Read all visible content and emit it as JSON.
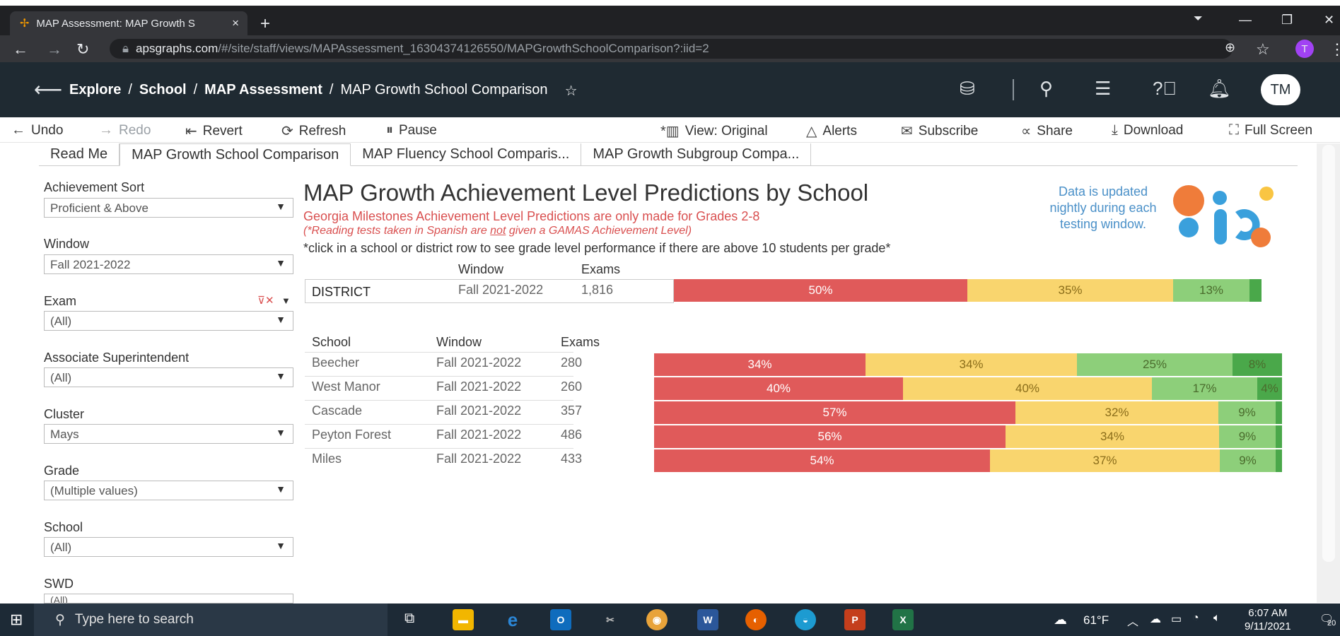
{
  "browser": {
    "tab_title": "MAP Assessment: MAP Growth S",
    "tab_close": "×",
    "new_tab": "+",
    "url_host": "apsgraphs.com",
    "url_path": "/#/site/staff/views/MAPAssessment_16304374126550/MAPGrowthSchoolComparison?:iid=2",
    "profile_initial": "T"
  },
  "header": {
    "crumbs": [
      "Explore",
      "/",
      "School",
      "/",
      "MAP Assessment",
      "/",
      "MAP Growth School Comparison"
    ],
    "avatar": "TM"
  },
  "toolbar": {
    "undo": "Undo",
    "redo": "Redo",
    "revert": "Revert",
    "refresh": "Refresh",
    "pause": "Pause",
    "view": "View: Original",
    "alerts": "Alerts",
    "subscribe": "Subscribe",
    "share": "Share",
    "download": "Download",
    "fullscreen": "Full Screen"
  },
  "sheet_tabs": [
    "Read Me",
    "MAP Growth School Comparison",
    "MAP Fluency School Comparis...",
    "MAP Growth Subgroup Compa..."
  ],
  "filters": [
    {
      "label": "Achievement Sort",
      "value": "Proficient & Above"
    },
    {
      "label": "Window",
      "value": "Fall 2021-2022"
    },
    {
      "label": "Exam",
      "value": "(All)"
    },
    {
      "label": "Associate Superintendent",
      "value": "(All)"
    },
    {
      "label": "Cluster",
      "value": "Mays"
    },
    {
      "label": "Grade",
      "value": "(Multiple values)"
    },
    {
      "label": "School",
      "value": "(All)"
    },
    {
      "label": "SWD",
      "value": "(All)"
    }
  ],
  "dashboard": {
    "title": "MAP Growth Achievement Level Predictions by School",
    "subtitle_red": "Georgia Milestones Achievement Level Predictions are only made for Grades 2-8",
    "subtitle_note_pre": "(*Reading tests taken in Spanish are ",
    "subtitle_note_em": "not",
    "subtitle_note_post": " given a GAMAS Achievement Level)",
    "subtitle_click": "*click in a school or district row to see grade level performance if there are above 10 students per grade*",
    "update_note": "Data is updated nightly during each testing window.",
    "col_window": "Window",
    "col_exams": "Exams",
    "col_school": "School",
    "colors": {
      "red": "#e05a5a",
      "yellow": "#f9d56e",
      "green": "#8dcf7a",
      "dark_green": "#4aa84a"
    }
  },
  "chart_data": {
    "type": "table",
    "district": {
      "label": "DISTRICT",
      "window": "Fall 2021-2022",
      "exams": "1,816",
      "segments": [
        50,
        35,
        13,
        2
      ],
      "labels": [
        "50%",
        "35%",
        "13%",
        ""
      ]
    },
    "schools": [
      {
        "name": "Beecher",
        "window": "Fall 2021-2022",
        "exams": "280",
        "segments": [
          34,
          34,
          25,
          8
        ],
        "labels": [
          "34%",
          "34%",
          "25%",
          "8%"
        ]
      },
      {
        "name": "West Manor",
        "window": "Fall 2021-2022",
        "exams": "260",
        "segments": [
          40,
          40,
          17,
          4
        ],
        "labels": [
          "40%",
          "40%",
          "17%",
          "4%"
        ]
      },
      {
        "name": "Cascade",
        "window": "Fall 2021-2022",
        "exams": "357",
        "segments": [
          57,
          32,
          9,
          1
        ],
        "labels": [
          "57%",
          "32%",
          "9%",
          ""
        ]
      },
      {
        "name": "Peyton Forest",
        "window": "Fall 2021-2022",
        "exams": "486",
        "segments": [
          56,
          34,
          9,
          1
        ],
        "labels": [
          "56%",
          "34%",
          "9%",
          ""
        ]
      },
      {
        "name": "Miles",
        "window": "Fall 2021-2022",
        "exams": "433",
        "segments": [
          54,
          37,
          9,
          1
        ],
        "labels": [
          "54%",
          "37%",
          "9%",
          ""
        ]
      }
    ]
  },
  "taskbar": {
    "search_placeholder": "Type here to search",
    "weather": "61°F",
    "time": "6:07 AM",
    "date": "9/11/2021",
    "notif": "20"
  }
}
